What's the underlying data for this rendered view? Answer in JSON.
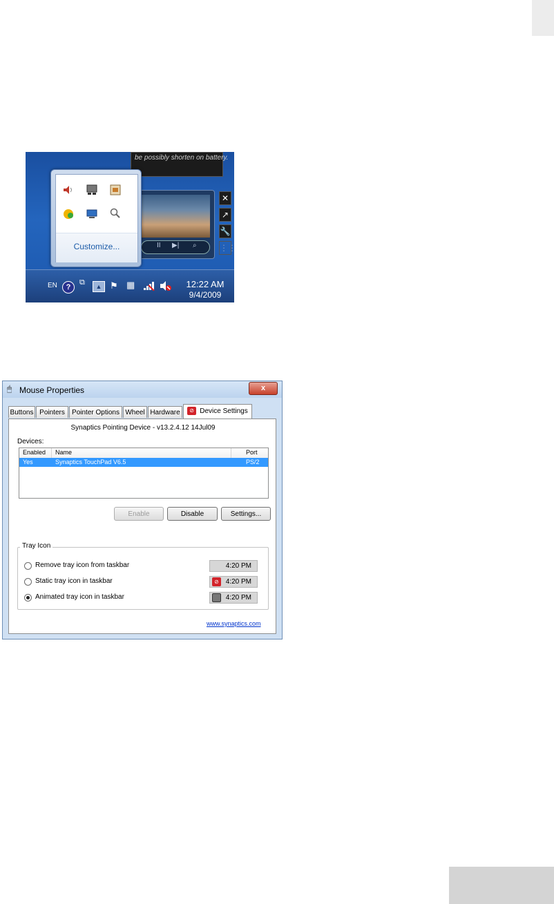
{
  "tray_screenshot": {
    "gadget_text": "be possibly shorten on battery.",
    "overflow_popup": {
      "icons": [
        "speaker-icon",
        "synaptics-touchpad-icon",
        "app-tray-icon",
        "update-icon",
        "network-monitor-icon",
        "search-magnifier-icon"
      ],
      "customize_label": "Customize..."
    },
    "media_controls": {
      "pause_label": "II",
      "next_label": "▶|"
    },
    "side_buttons": [
      "✕",
      "↗",
      "🔧",
      "⋮⋮"
    ],
    "taskbar": {
      "language": "EN",
      "help_label": "?",
      "time": "12:22 AM",
      "date": "9/4/2009"
    }
  },
  "mouse_properties": {
    "title": "Mouse Properties",
    "close_label": "x",
    "tabs": [
      "Buttons",
      "Pointers",
      "Pointer Options",
      "Wheel",
      "Hardware",
      "Device Settings"
    ],
    "device_title": "Synaptics Pointing Device - v13.2.4.12 14Jul09",
    "devices_label": "Devices:",
    "columns": [
      "Enabled",
      "Name",
      "Port"
    ],
    "rows": [
      {
        "enabled": "Yes",
        "name": "Synaptics TouchPad V6.5",
        "port": "PS/2"
      }
    ],
    "buttons": {
      "enable": "Enable",
      "disable": "Disable",
      "settings": "Settings..."
    },
    "tray_icon": {
      "group_label": "Tray Icon",
      "options": [
        {
          "label": "Remove tray icon from taskbar",
          "selected": false,
          "preview_time": "4:20 PM",
          "preview_icon": ""
        },
        {
          "label": "Static tray icon in taskbar",
          "selected": false,
          "preview_time": "4:20 PM",
          "preview_icon": "synaptics-static-icon"
        },
        {
          "label": "Animated tray icon in taskbar",
          "selected": true,
          "preview_time": "4:20 PM",
          "preview_icon": "synaptics-animated-icon"
        }
      ]
    },
    "link": "www.synaptics.com",
    "colors": {
      "selection": "#3399ff",
      "synaptics_red": "#d2232a",
      "link": "#0033cc"
    }
  }
}
